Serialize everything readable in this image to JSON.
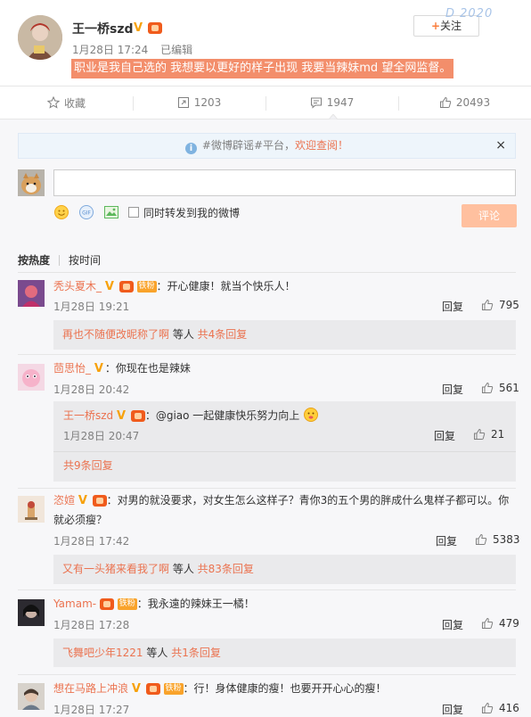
{
  "post": {
    "username": "王一桥szd",
    "time": "1月28日 17:24",
    "edited": "已编辑",
    "text": "职业是我自己选的 我想要以更好的样子出现 我要当辣妹md  望全网监督。",
    "follow_label": "关注",
    "follow_plus": "+",
    "watermark": "D 2020"
  },
  "actions": {
    "favorite": "收藏",
    "repost": "1203",
    "comment": "1947",
    "like": "20493"
  },
  "notice": {
    "prefix": "#微博辟谣#平台，",
    "link": "欢迎查阅！",
    "close": "×"
  },
  "composer": {
    "repost_label": "同时转发到我的微博",
    "submit_label": "评论"
  },
  "sort": {
    "hot": "按热度",
    "time": "按时间"
  },
  "comments": [
    {
      "user": "秃头夏木_",
      "fan_badge": "铁粉",
      "text": "：开心健康！就当个快乐人！",
      "time": "1月28日 19:21",
      "reply": "回复",
      "likes": "795",
      "sub_link": "再也不随便改昵称了啊",
      "sub_mid": " 等人 ",
      "sub_count": "共4条回复"
    },
    {
      "user": "茴思怡_",
      "text": "：你现在也是辣妹",
      "time": "1月28日 20:42",
      "reply": "回复",
      "likes": "561",
      "nested": {
        "user": "王一桥szd",
        "text": "：@giao 一起健康快乐努力向上",
        "time": "1月28日 20:47",
        "reply": "回复",
        "likes": "21"
      },
      "sub_count": "共9条回复"
    },
    {
      "user": "恣媗",
      "text": "：对男的就没要求，对女生怎么这样子？青你3的五个男的胖成什么鬼样子都可以。你就必须瘦？",
      "time": "1月28日 17:42",
      "reply": "回复",
      "likes": "5383",
      "sub_link": "又有一头猪来看我了啊",
      "sub_mid": " 等人 ",
      "sub_count": "共83条回复"
    },
    {
      "user": "Yamam-",
      "fan_badge": "铁粉",
      "text": "：我永遠的辣妹王一橘！",
      "time": "1月28日 17:28",
      "reply": "回复",
      "likes": "479",
      "sub_link": "飞舞吧少年1221",
      "sub_mid": " 等人 ",
      "sub_count": "共1条回复"
    },
    {
      "user": "想在马路上冲浪",
      "fan_badge": "铁粉",
      "text": "：行！身体健康的瘦！也要开开心心的瘦！",
      "time": "1月28日 17:27",
      "reply": "回复",
      "likes": "416"
    }
  ]
}
